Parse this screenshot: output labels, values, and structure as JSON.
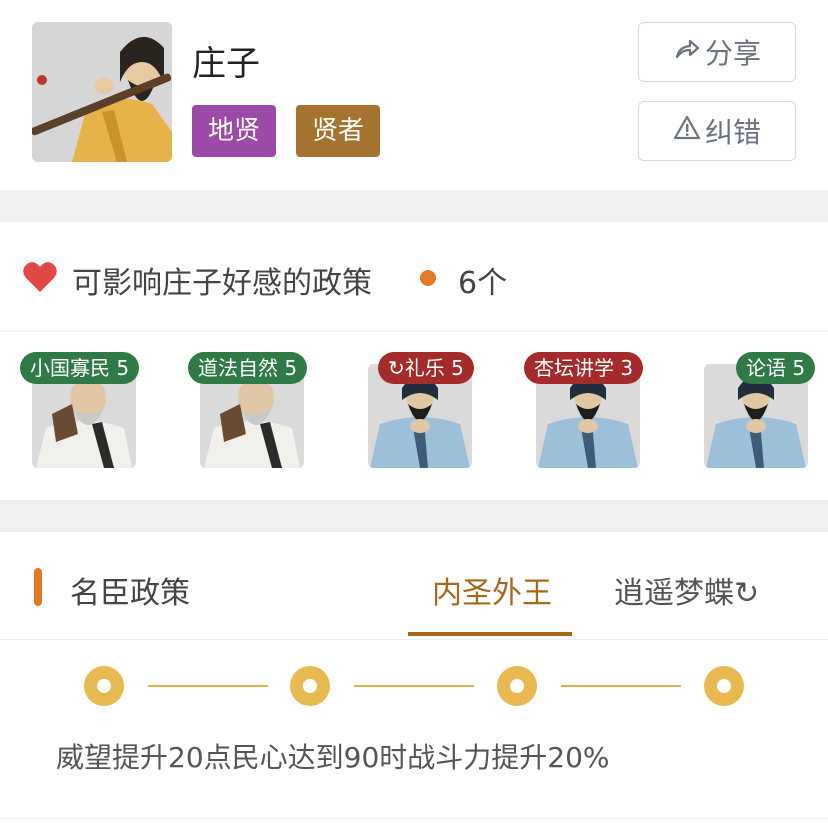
{
  "profile": {
    "name": "庄子",
    "tags": [
      "地贤",
      "贤者"
    ],
    "share_label": "分享",
    "report_label": "纠错",
    "share_icon": "share-arrow-icon",
    "report_icon": "warning-triangle-icon"
  },
  "favor": {
    "title": "可影响庄子好感的政策",
    "count": "6个",
    "heart_color": "#e04848",
    "cards": [
      {
        "badge": "小国寡民 5",
        "badge_color": "#2f7a47",
        "figure": "white-robed-sage"
      },
      {
        "badge": "道法自然 5",
        "badge_color": "#2f7a47",
        "figure": "white-robed-sage"
      },
      {
        "badge": "↻礼乐 5",
        "badge_color": "#a32b2b",
        "figure": "blue-robed-scholar"
      },
      {
        "badge": "杏坛讲学 3",
        "badge_color": "#a32b2b",
        "figure": "blue-robed-scholar"
      },
      {
        "badge": "论语 5",
        "badge_color": "#2f7a47",
        "figure": "blue-robed-scholar"
      }
    ]
  },
  "policy": {
    "section_title": "名臣政策",
    "tabs": [
      "内圣外王",
      "逍遥梦蝶↻"
    ],
    "active_tab": "内圣外王",
    "timeline_nodes": 4,
    "effect": "威望提升20点民心达到90时战斗力提升20%"
  }
}
